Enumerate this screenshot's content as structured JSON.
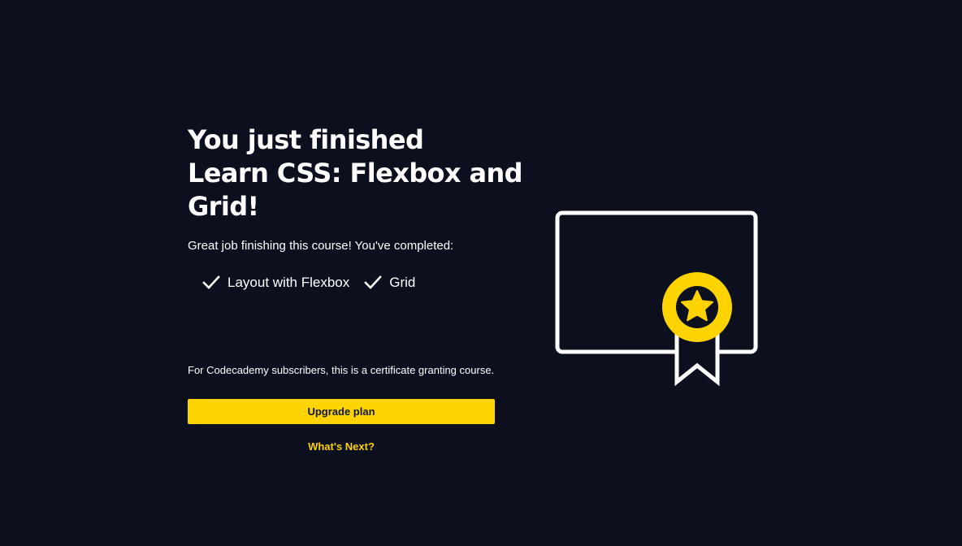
{
  "completion": {
    "title_line1": "You just finished",
    "title_line2": "Learn CSS: Flexbox and",
    "title_line3": "Grid!",
    "subtitle": "Great job finishing this course! You've completed:",
    "items": [
      {
        "label": "Layout with Flexbox",
        "icon": "checkmark-icon"
      },
      {
        "label": "Grid",
        "icon": "checkmark-icon"
      }
    ],
    "note": "For Codecademy subscribers, this is a certificate granting course.",
    "upgrade_label": "Upgrade plan",
    "next_label": "What's Next?"
  },
  "illustration": {
    "icon": "certificate-icon",
    "accent_color": "#ffd300",
    "outline_color": "#ffffff"
  },
  "colors": {
    "background": "#0b0f1e",
    "accent": "#ffd300",
    "button_text": "#10162f"
  }
}
